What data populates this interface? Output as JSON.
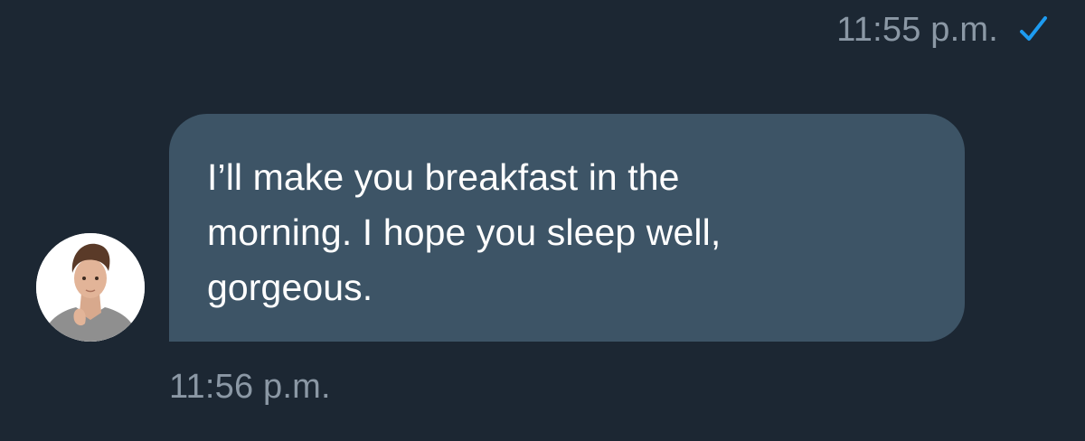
{
  "conversation": {
    "sent_meta": {
      "time": "11:55 p.m.",
      "status_icon": "checkmark-icon",
      "status_color": "#1d9bf0"
    },
    "incoming_message": {
      "avatar_icon": "contact-avatar",
      "text": "I’ll make you breakfast in the\nmorning. I hope you sleep well,\ngorgeous.",
      "time": "11:56 p.m.",
      "bubble_color": "#3d5466"
    },
    "colors": {
      "background": "#1c2733",
      "muted_text": "#8b98a5",
      "message_text": "#ffffff"
    }
  }
}
